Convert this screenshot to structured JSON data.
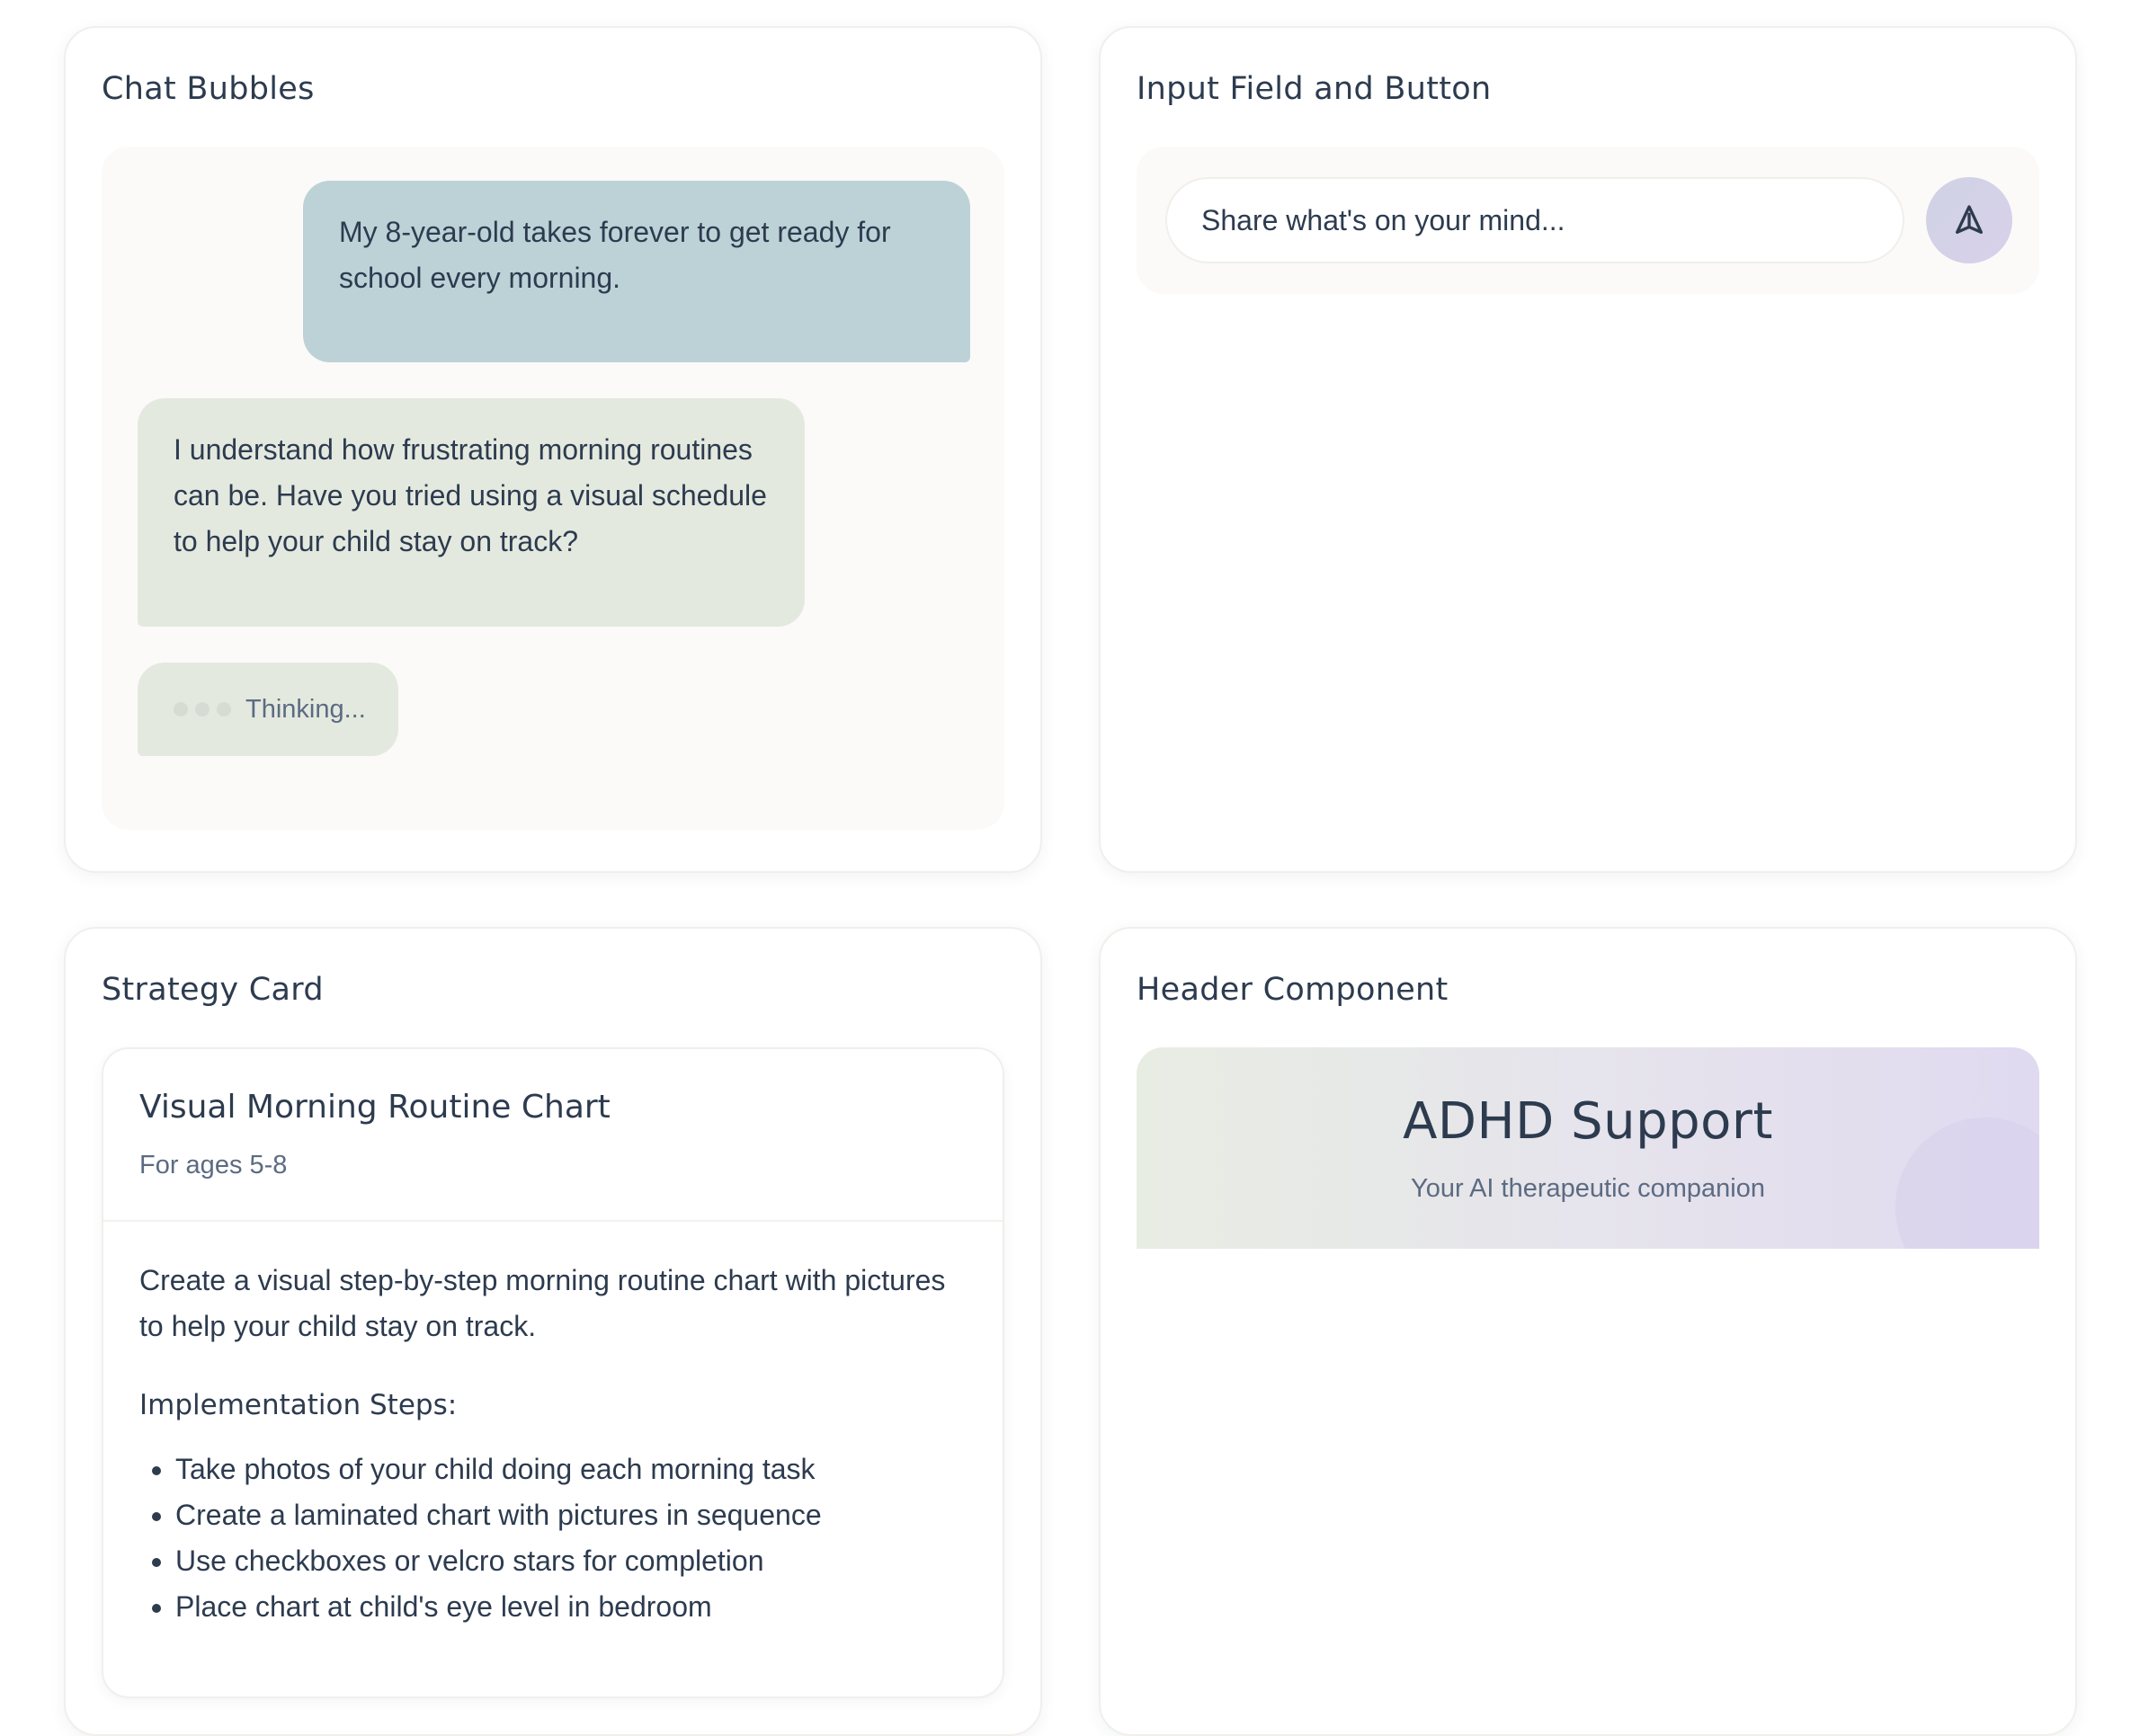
{
  "panels": {
    "chat": {
      "title": "Chat Bubbles",
      "user_message": "My 8-year-old takes forever to get ready for school every morning.",
      "ai_message": "I understand how frustrating morning routines can be. Have you tried using a visual schedule to help your child stay on track?",
      "thinking_label": "Thinking..."
    },
    "input": {
      "title": "Input Field and Button",
      "placeholder": "Share what's on your mind...",
      "send_icon": "send-icon"
    },
    "strategy": {
      "title": "Strategy Card",
      "card_title": "Visual Morning Routine Chart",
      "card_subtitle": "For ages 5-8",
      "description": "Create a visual step-by-step morning routine chart with pictures to help your child stay on track.",
      "steps_title": "Implementation Steps:",
      "steps": [
        "Take photos of your child doing each morning task",
        "Create a laminated chart with pictures in sequence",
        "Use checkboxes or velcro stars for completion",
        "Place chart at child's eye level in bedroom"
      ]
    },
    "header": {
      "title": "Header Component",
      "app_title": "ADHD Support",
      "app_subtitle": "Your AI therapeutic companion"
    }
  },
  "colors": {
    "user_bubble": "#bcd2d7",
    "ai_bubble": "#e4e9df",
    "text_primary": "#2d3b4f",
    "text_secondary": "#5c6b82"
  }
}
